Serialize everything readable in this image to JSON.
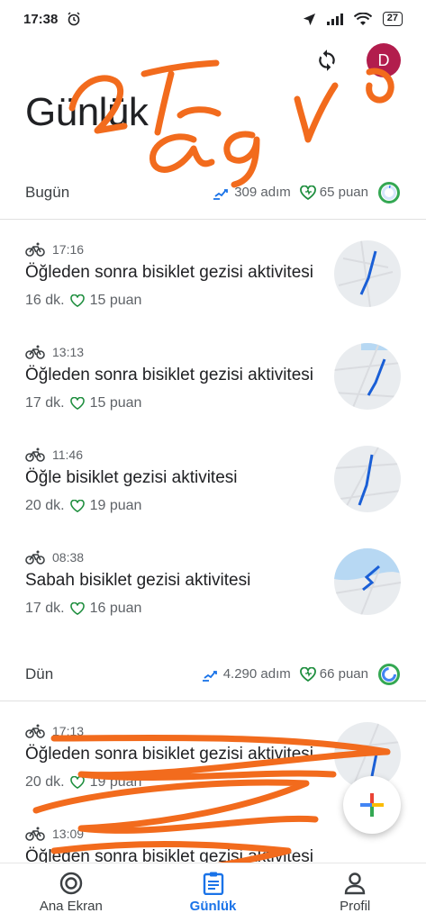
{
  "status_bar": {
    "time": "17:38",
    "battery": "27"
  },
  "header": {
    "title": "Günlük",
    "avatar_initial": "D"
  },
  "sections": [
    {
      "title": "Bugün",
      "steps": "309 adım",
      "points": "65 puan",
      "activities": [
        {
          "time": "17:16",
          "title": "Öğleden sonra bisiklet gezisi aktivitesi",
          "duration": "16 dk.",
          "points": "15 puan"
        },
        {
          "time": "13:13",
          "title": "Öğleden sonra bisiklet gezisi aktivitesi",
          "duration": "17 dk.",
          "points": "15 puan"
        },
        {
          "time": "11:46",
          "title": "Öğle bisiklet gezisi aktivitesi",
          "duration": "20 dk.",
          "points": "19 puan"
        },
        {
          "time": "08:38",
          "title": "Sabah bisiklet gezisi aktivitesi",
          "duration": "17 dk.",
          "points": "16 puan"
        }
      ]
    },
    {
      "title": "Dün",
      "steps": "4.290 adım",
      "points": "66 puan",
      "activities": [
        {
          "time": "17:13",
          "title": "Öğleden sonra bisiklet gezisi aktivitesi",
          "duration": "20 dk.",
          "points": "19 puan"
        },
        {
          "time": "13:09",
          "title": "Öğleden sonra bisiklet gezisi aktivitesi",
          "duration": "",
          "points": ""
        }
      ]
    }
  ],
  "bottom_nav": [
    {
      "label": "Ana Ekran",
      "icon": "home-ring-icon"
    },
    {
      "label": "Günlük",
      "icon": "journal-icon",
      "active": true
    },
    {
      "label": "Profil",
      "icon": "person-icon"
    }
  ],
  "colors": {
    "accent": "#1a73e8",
    "heart": "#1e8e3e",
    "ring_blue": "#4285f4",
    "ring_green": "#34a853",
    "avatar": "#b21d4d",
    "scribble": "#f26b1d"
  }
}
